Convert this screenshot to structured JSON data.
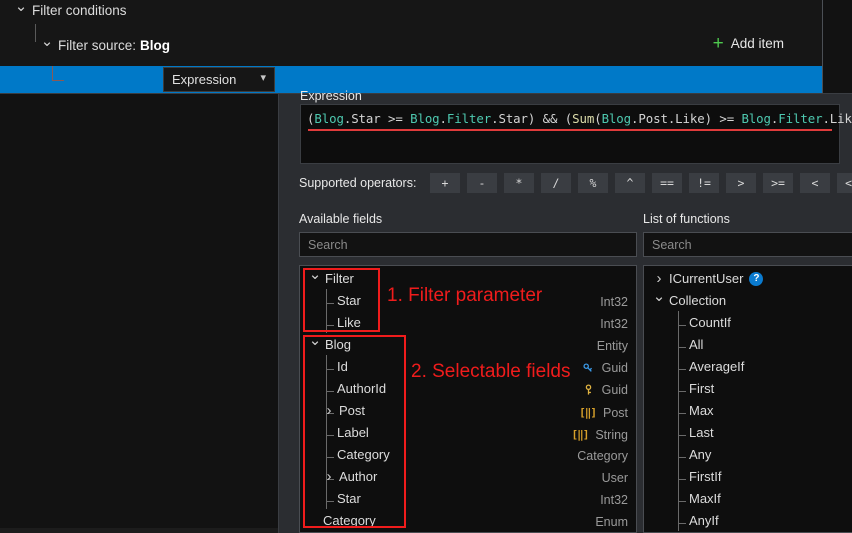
{
  "tree": {
    "root_label": "Filter conditions",
    "source_label": "Filter source:",
    "source_value": "Blog",
    "add_item_label": "Add item",
    "add_item_icon": "plus-icon",
    "selected_type": "Expression",
    "dropdown_icon": "chevron-down-icon"
  },
  "expression": {
    "section_label": "Expression",
    "value": "(Blog.Star >= Blog.Filter.Star) && (Sum(Blog.Post.Like) >= Blog.Filter.Like)",
    "tokens": [
      {
        "t": "(",
        "k": "punct"
      },
      {
        "t": "Blog",
        "k": "ident"
      },
      {
        "t": ".Star ",
        "k": "punct"
      },
      {
        "t": ">= ",
        "k": "op"
      },
      {
        "t": "Blog",
        "k": "ident"
      },
      {
        "t": ".",
        "k": "punct"
      },
      {
        "t": "Filter",
        "k": "ident"
      },
      {
        "t": ".Star) ",
        "k": "punct"
      },
      {
        "t": "&& ",
        "k": "op"
      },
      {
        "t": "(",
        "k": "punct"
      },
      {
        "t": "Sum",
        "k": "func"
      },
      {
        "t": "(",
        "k": "punct"
      },
      {
        "t": "Blog",
        "k": "ident"
      },
      {
        "t": ".Post.Like) ",
        "k": "punct"
      },
      {
        "t": ">= ",
        "k": "op"
      },
      {
        "t": "Blog",
        "k": "ident"
      },
      {
        "t": ".",
        "k": "punct"
      },
      {
        "t": "Filter",
        "k": "ident"
      },
      {
        "t": ".Like)",
        "k": "punct"
      }
    ],
    "has_error_underline": true
  },
  "operators": {
    "label": "Supported operators:",
    "items": [
      "+",
      "-",
      "*",
      "/",
      "%",
      "^",
      "==",
      "!=",
      ">",
      ">=",
      "<",
      "<="
    ]
  },
  "available_fields": {
    "label": "Available fields",
    "search_placeholder": "Search",
    "nodes": [
      {
        "label": "Filter",
        "type": "",
        "depth": 0,
        "toggle": "down",
        "icon": ""
      },
      {
        "label": "Star",
        "type": "Int32",
        "depth": 1,
        "toggle": "",
        "icon": ""
      },
      {
        "label": "Like",
        "type": "Int32",
        "depth": 1,
        "toggle": "",
        "icon": ""
      },
      {
        "label": "Blog",
        "type": "Entity",
        "depth": 0,
        "toggle": "down",
        "icon": ""
      },
      {
        "label": "Id",
        "type": "Guid",
        "depth": 1,
        "toggle": "",
        "icon": "primary-key-icon"
      },
      {
        "label": "AuthorId",
        "type": "Guid",
        "depth": 1,
        "toggle": "",
        "icon": "foreign-key-icon"
      },
      {
        "label": "Post",
        "type": "Post",
        "depth": 1,
        "toggle": "right",
        "icon": "collection-icon"
      },
      {
        "label": "Label",
        "type": "String",
        "depth": 1,
        "toggle": "",
        "icon": "collection-icon"
      },
      {
        "label": "Category",
        "type": "Category",
        "depth": 1,
        "toggle": "",
        "icon": ""
      },
      {
        "label": "Author",
        "type": "User",
        "depth": 1,
        "toggle": "right",
        "icon": ""
      },
      {
        "label": "Star",
        "type": "Int32",
        "depth": 1,
        "toggle": "",
        "icon": ""
      },
      {
        "label": "Category",
        "type": "Enum",
        "depth": 0,
        "toggle": "",
        "icon": ""
      }
    ]
  },
  "functions": {
    "label": "List of functions",
    "search_placeholder": "Search",
    "nodes": [
      {
        "label": "ICurrentUser",
        "depth": 0,
        "toggle": "right",
        "badge": "?"
      },
      {
        "label": "Collection",
        "depth": 0,
        "toggle": "down",
        "badge": ""
      },
      {
        "label": "CountIf",
        "depth": 1,
        "toggle": "",
        "badge": ""
      },
      {
        "label": "All",
        "depth": 1,
        "toggle": "",
        "badge": ""
      },
      {
        "label": "AverageIf",
        "depth": 1,
        "toggle": "",
        "badge": ""
      },
      {
        "label": "First",
        "depth": 1,
        "toggle": "",
        "badge": ""
      },
      {
        "label": "Max",
        "depth": 1,
        "toggle": "",
        "badge": ""
      },
      {
        "label": "Last",
        "depth": 1,
        "toggle": "",
        "badge": ""
      },
      {
        "label": "Any",
        "depth": 1,
        "toggle": "",
        "badge": ""
      },
      {
        "label": "FirstIf",
        "depth": 1,
        "toggle": "",
        "badge": ""
      },
      {
        "label": "MaxIf",
        "depth": 1,
        "toggle": "",
        "badge": ""
      },
      {
        "label": "AnyIf",
        "depth": 1,
        "toggle": "",
        "badge": ""
      }
    ]
  },
  "annotations": [
    {
      "text": "1. Filter parameter",
      "color": "#f01c1c"
    },
    {
      "text": "2. Selectable fields",
      "color": "#f01c1c"
    }
  ],
  "colors": {
    "selection_blue": "#0079c8",
    "panel_bg": "#2b2d31",
    "annotation_red": "#f01c1c",
    "add_item_green": "#4ec94e",
    "identifier_teal": "#4ec9b0",
    "function_yellow": "#dcdcaa"
  }
}
